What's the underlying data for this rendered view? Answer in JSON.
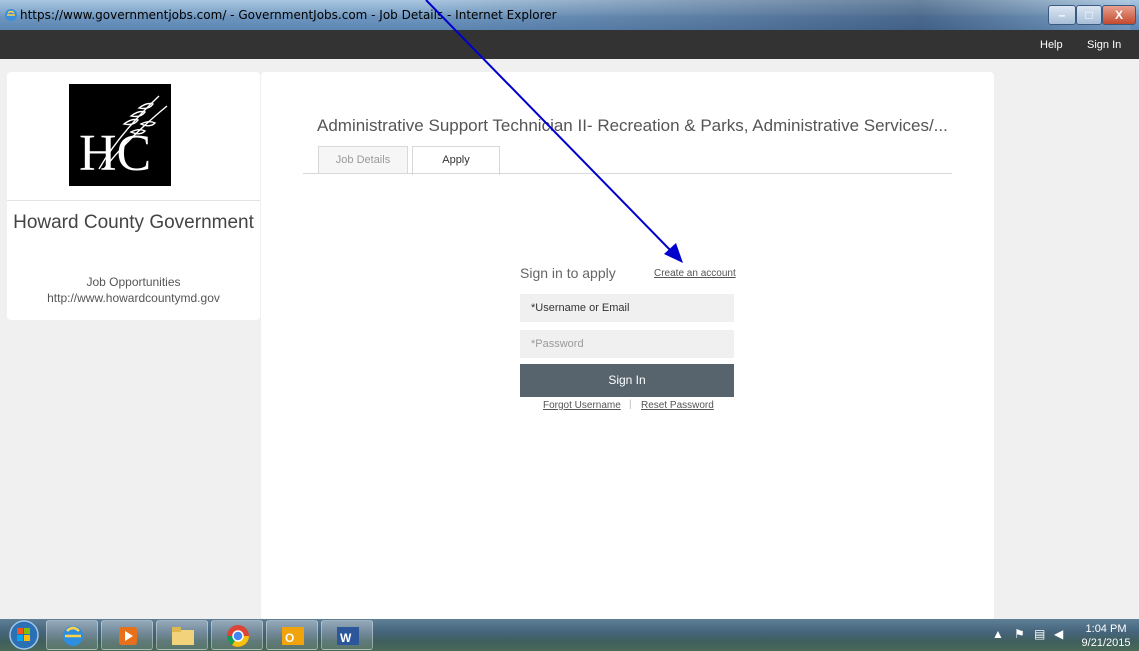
{
  "window": {
    "title": "https://www.governmentjobs.com/ - GovernmentJobs.com - Job Details - Internet Explorer",
    "controls": {
      "minimize": "–",
      "maximize": "□",
      "close": "X"
    }
  },
  "nav": {
    "help": "Help",
    "sign_in": "Sign In"
  },
  "agency": {
    "logo_text": "HC",
    "name": "Howard County Government",
    "subtitle": "Job Opportunities",
    "url": "http://www.howardcountymd.gov"
  },
  "job": {
    "title": "Administrative Support Technician II- Recreation & Parks, Administrative Services/...",
    "tabs": [
      {
        "label": "Job Details"
      },
      {
        "label": "Apply"
      }
    ]
  },
  "signin": {
    "heading": "Sign in to apply",
    "create_account": "Create an account",
    "username_placeholder": "*Username or Email",
    "password_placeholder": "*Password",
    "button": "Sign In",
    "forgot_username": "Forgot Username",
    "separator": "|",
    "reset_password": "Reset Password"
  },
  "taskbar": {
    "apps": [
      "start-orb",
      "internet-explorer",
      "media-player",
      "file-explorer",
      "chrome",
      "outlook",
      "word"
    ],
    "time": "1:04 PM",
    "date": "9/21/2015"
  },
  "colors": {
    "nav_bg": "#333333",
    "signin_button": "#57636d",
    "arrow": "#0000cc"
  }
}
